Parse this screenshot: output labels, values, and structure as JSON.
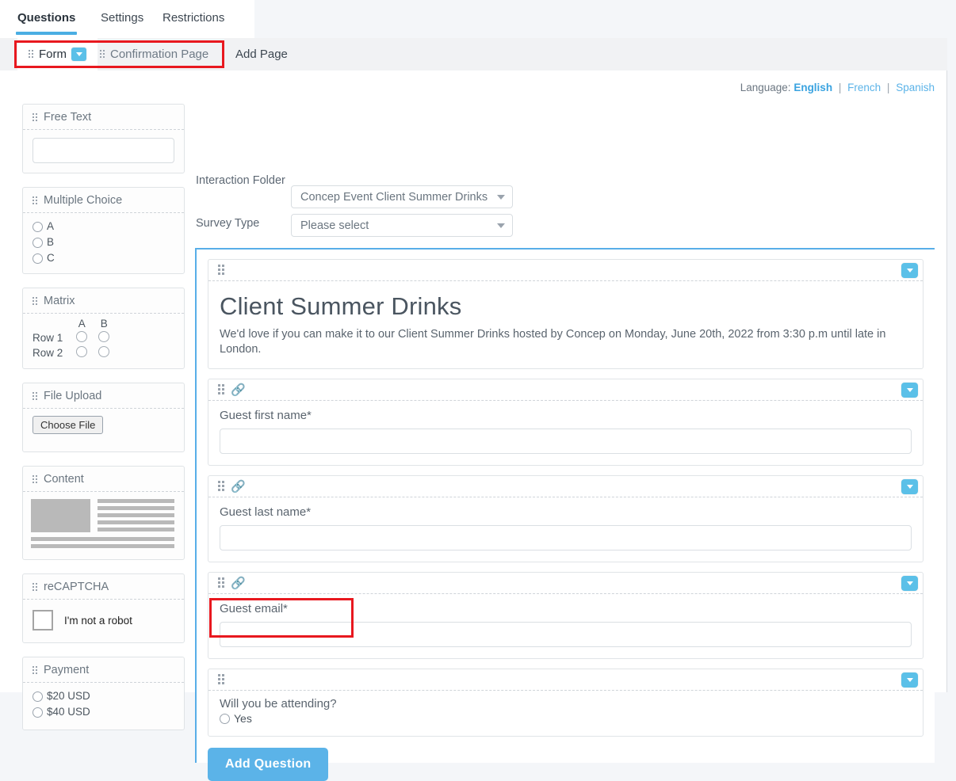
{
  "top_tabs": [
    {
      "label": "Questions",
      "active": true
    },
    {
      "label": "Settings",
      "active": false
    },
    {
      "label": "Restrictions",
      "active": false
    }
  ],
  "page_tabs": {
    "form": "Form",
    "confirmation": "Confirmation Page",
    "add_page": "Add Page"
  },
  "language": {
    "label": "Language:",
    "current": "English",
    "options": [
      "English",
      "French",
      "Spanish"
    ],
    "sep": "|"
  },
  "form_fields": {
    "interaction_folder_label": "Interaction Folder",
    "interaction_folder_value": "Concep Event Client Summer Drinks",
    "survey_type_label": "Survey Type",
    "survey_type_value": "Please select"
  },
  "palette": {
    "free_text": {
      "title": "Free Text"
    },
    "multiple_choice": {
      "title": "Multiple Choice",
      "options": [
        "A",
        "B",
        "C"
      ]
    },
    "matrix": {
      "title": "Matrix",
      "columns": [
        "A",
        "B"
      ],
      "rows": [
        "Row 1",
        "Row 2"
      ]
    },
    "file_upload": {
      "title": "File Upload",
      "button": "Choose File"
    },
    "content": {
      "title": "Content"
    },
    "recaptcha": {
      "title": "reCAPTCHA",
      "text": "I'm not a robot"
    },
    "payment": {
      "title": "Payment",
      "options": [
        "$20 USD",
        "$40 USD"
      ]
    }
  },
  "survey": {
    "header": {
      "title": "Client Summer Drinks",
      "description": "We'd love if you can make it to our Client Summer Drinks hosted by Concep on Monday, June 20th, 2022 from 3:30 p.m until late in London."
    },
    "questions": [
      {
        "label": "Guest first name*",
        "type": "text",
        "has_link_icon": true
      },
      {
        "label": "Guest last name*",
        "type": "text",
        "has_link_icon": true
      },
      {
        "label": "Guest email*",
        "type": "text",
        "has_link_icon": true
      },
      {
        "label": "Will you be attending?",
        "type": "radio",
        "has_link_icon": false,
        "options": [
          "Yes"
        ]
      }
    ],
    "add_question_button": "Add Question"
  },
  "colors": {
    "accent_blue": "#5bb3e8",
    "tab_underline": "#4aaee3",
    "canvas_border": "#58aee8",
    "annotation_red": "#e8181f",
    "link_blue": "#3aa3e0"
  }
}
